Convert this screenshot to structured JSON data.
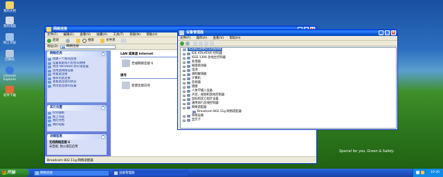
{
  "desktop": {
    "icons": [
      {
        "label": "我的文档"
      },
      {
        "label": "我的电脑"
      },
      {
        "label": "网上邻居"
      },
      {
        "label": "回收站"
      },
      {
        "label": "Internet Explorer"
      },
      {
        "label": "软件下载"
      }
    ],
    "branding": "Special for you, Green & Safety."
  },
  "network_window": {
    "title": "网络连接",
    "menu": [
      "文件(F)",
      "编辑(E)",
      "查看(V)",
      "收藏(A)",
      "工具(T)",
      "高级(N)",
      "帮助(H)"
    ],
    "toolbar": {
      "back_label": "后退",
      "search_label": "搜索",
      "folders_label": "文件夹"
    },
    "address": {
      "label": "地址(D)",
      "value": "网络连接"
    },
    "network_tasks": {
      "header": "网络任务",
      "items": [
        "创建一个新的连接",
        "设置家庭或小型办公网络",
        "更改 Windows 防火墙设置",
        "禁用此网络设备",
        "修复此连接",
        "重命名此连接",
        "查看此连接的状态",
        "更改此连接的设置"
      ]
    },
    "other_places": {
      "header": "其它位置",
      "items": [
        "控制面板",
        "网上邻居",
        "我的文档",
        "我的电脑"
      ]
    },
    "details": {
      "header": "详细信息",
      "line1": "无线网络连接 6",
      "line2": "未连接, 防火墙已启用"
    },
    "content": {
      "group1": "LAN 或高速 Internet",
      "conn1": "无线网络连接 6",
      "group2": "拨号",
      "conn2": "新建连接向导"
    },
    "status_bar": "Broadcom 802.11g 网络适配器"
  },
  "device_manager": {
    "title": "设备管理器",
    "menu": [
      "文件(F)",
      "操作(A)",
      "查看(V)",
      "帮助(H)"
    ],
    "root": "YOURCOMPUTERNAME",
    "nodes": [
      {
        "label": "IDE ATA/ATAPI 控制器",
        "expand": "+"
      },
      {
        "label": "IEEE 1394 总线主控制器",
        "expand": "+"
      },
      {
        "label": "处理器",
        "expand": "+"
      },
      {
        "label": "磁盘驱动器",
        "expand": "+"
      },
      {
        "label": "电池",
        "expand": "+"
      },
      {
        "label": "调制解调器",
        "expand": "+"
      },
      {
        "label": "计算机",
        "expand": "+"
      },
      {
        "label": "监视器",
        "expand": "+"
      },
      {
        "label": "键盘",
        "expand": "+"
      },
      {
        "label": "人体学输入设备",
        "expand": "+"
      },
      {
        "label": "声音、视频和游戏控制器",
        "expand": "+"
      },
      {
        "label": "鼠标和其它指针设备",
        "expand": "+"
      },
      {
        "label": "通用串行总线控制器",
        "expand": "+"
      },
      {
        "label": "网络适配器",
        "expand": "-"
      },
      {
        "label": "Broadcom 802.11g 网络适配器",
        "expand": ""
      },
      {
        "label": "系统设备",
        "expand": "+"
      },
      {
        "label": "显示卡",
        "expand": "+"
      }
    ]
  },
  "taskbar": {
    "start_label": "开始",
    "items": [
      "网络连接",
      "设备管理器"
    ],
    "clock": "19:30"
  },
  "colors": {
    "titlebar": "#0a5ee8",
    "taskbar": "#245edb",
    "start": "#2f8a2f",
    "panel": "#d6dff7"
  }
}
